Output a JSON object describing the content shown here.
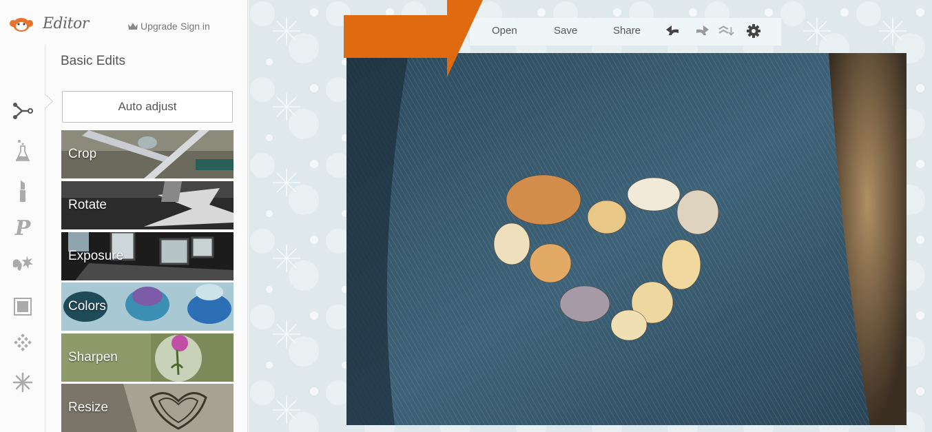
{
  "app": {
    "name": "Editor",
    "upgrade_label": "Upgrade",
    "signin_label": "Sign in",
    "accent": "#e8722a"
  },
  "sidebar": {
    "section_title": "Basic Edits",
    "auto_adjust_label": "Auto adjust",
    "rail_icons": [
      "basic-edits-icon",
      "effects-flask-icon",
      "touch-up-lipstick-icon",
      "text-p-icon",
      "overlays-butterfly-icon",
      "frames-icon",
      "textures-icon",
      "seasonal-snowflake-icon"
    ],
    "tools": [
      {
        "label": "Crop"
      },
      {
        "label": "Rotate"
      },
      {
        "label": "Exposure"
      },
      {
        "label": "Colors"
      },
      {
        "label": "Sharpen"
      },
      {
        "label": "Resize"
      }
    ]
  },
  "toolbar": {
    "open_label": "Open",
    "save_label": "Save",
    "share_label": "Share",
    "icons": [
      "undo-icon",
      "redo-icon",
      "history-icon",
      "settings-gear-icon"
    ]
  },
  "annotation": {
    "arrow_color": "#e06a10"
  }
}
